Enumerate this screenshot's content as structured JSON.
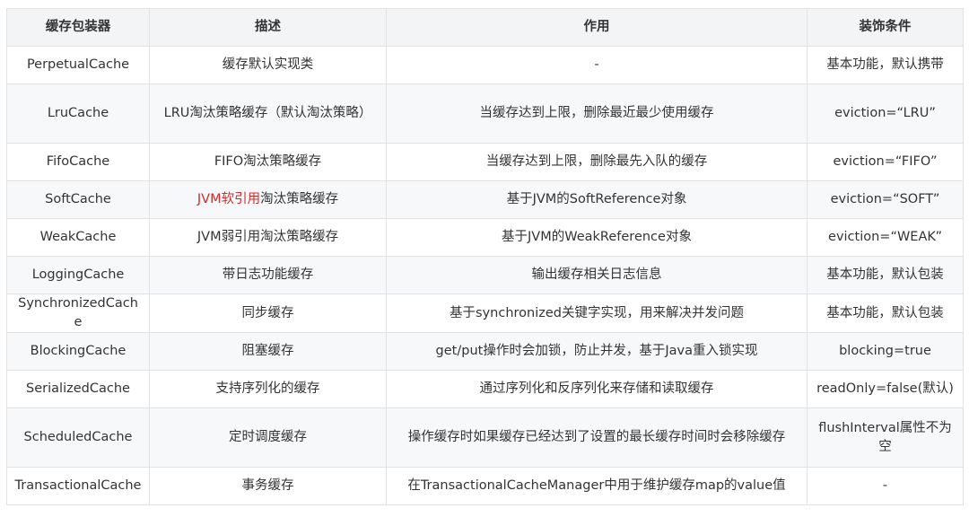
{
  "headers": [
    "缓存包装器",
    "描述",
    "作用",
    "装饰条件"
  ],
  "rows": [
    {
      "name": "PerpetualCache",
      "desc": "缓存默认实现类",
      "desc_highlight": "",
      "effect": "-",
      "cond": "基本功能，默认携带"
    },
    {
      "name": "LruCache",
      "desc": "LRU淘汰策略缓存（默认淘汰策略）",
      "desc_highlight": "",
      "effect": "当缓存达到上限，删除最近最少使用缓存",
      "cond": "eviction=“LRU”"
    },
    {
      "name": "FifoCache",
      "desc": "FIFO淘汰策略缓存",
      "desc_highlight": "",
      "effect": "当缓存达到上限，删除最先入队的缓存",
      "cond": "eviction=“FIFO”"
    },
    {
      "name": "SoftCache",
      "desc": "淘汰策略缓存",
      "desc_highlight": "JVM软引用",
      "effect": "基于JVM的SoftReference对象",
      "cond": "eviction=“SOFT”"
    },
    {
      "name": "WeakCache",
      "desc": "JVM弱引用淘汰策略缓存",
      "desc_highlight": "",
      "effect": "基于JVM的WeakReference对象",
      "cond": "eviction=“WEAK”"
    },
    {
      "name": "LoggingCache",
      "desc": "带日志功能缓存",
      "desc_highlight": "",
      "effect": "输出缓存相关日志信息",
      "cond": "基本功能，默认包装"
    },
    {
      "name": "SynchronizedCache",
      "desc": "同步缓存",
      "desc_highlight": "",
      "effect": "基于synchronized关键字实现，用来解决并发问题",
      "cond": "基本功能，默认包装"
    },
    {
      "name": "BlockingCache",
      "desc": "阻塞缓存",
      "desc_highlight": "",
      "effect": "get/put操作时会加锁，防止并发，基于Java重入锁实现",
      "cond": "blocking=true"
    },
    {
      "name": "SerializedCache",
      "desc": "支持序列化的缓存",
      "desc_highlight": "",
      "effect": "通过序列化和反序列化来存储和读取缓存",
      "cond": "readOnly=false(默认)"
    },
    {
      "name": "ScheduledCache",
      "desc": "定时调度缓存",
      "desc_highlight": "",
      "effect": "操作缓存时如果缓存已经达到了设置的最长缓存时间时会移除缓存",
      "cond": "flushInterval属性不为空"
    },
    {
      "name": "TransactionalCache",
      "desc": "事务缓存",
      "desc_highlight": "",
      "effect": "在TransactionalCacheManager中用于维护缓存map的value值",
      "cond": "-"
    }
  ],
  "colors": {
    "header_bg": "#f3f4f6",
    "stripe_bg": "#f7f8f9",
    "border": "#e2e2e2",
    "highlight": "#d22b2b"
  }
}
